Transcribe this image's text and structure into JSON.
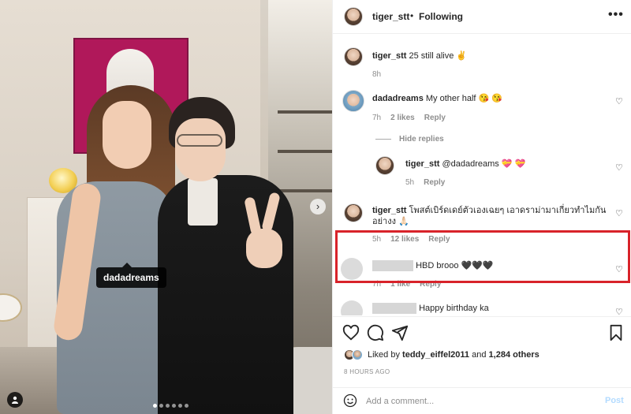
{
  "post": {
    "photo_tag": "dadadreams"
  },
  "header": {
    "username": "tiger_stt",
    "separator": "•",
    "follow_status": "Following",
    "more": "•••"
  },
  "caption": {
    "username": "tiger_stt",
    "text": "25 still alive ✌️",
    "time": "8h"
  },
  "comments": [
    {
      "username": "dadadreams",
      "text": "My other half 😘 😘",
      "time": "7h",
      "likes": "2 likes",
      "reply": "Reply"
    },
    {
      "hide_replies": "Hide replies"
    },
    {
      "username": "tiger_stt",
      "text": "@dadadreams 💝 💝",
      "time": "5h",
      "reply": "Reply"
    },
    {
      "username": "tiger_stt",
      "text": "โพสต์เบิร์ดเดย์ตัวเองเฉยๆ เอาดราม่ามาเกี่ยวทำไมกัน อย่างง 🙏🏻",
      "time": "5h",
      "likes": "12 likes",
      "reply": "Reply"
    },
    {
      "text": "HBD brooo 🖤🖤🖤",
      "time": "7h",
      "likes": "1 like",
      "reply": "Reply"
    },
    {
      "text": "Happy birthday ka"
    }
  ],
  "footer": {
    "liked_by_prefix": "Liked by",
    "liked_by_user": "teddy_eiffel2011",
    "and": "and",
    "others": "1,284 others",
    "time_ago": "8 HOURS AGO"
  },
  "add_comment": {
    "placeholder": "Add a comment...",
    "post_label": "Post"
  },
  "colors": {
    "highlight_border": "#d8232a",
    "post_button": "#b3dbff",
    "text": "#262626",
    "muted": "#8e8e8e"
  },
  "icons": [
    "heart-icon",
    "comment-icon",
    "share-icon",
    "bookmark-icon",
    "emoji-icon",
    "more-icon",
    "chevron-right-icon",
    "user-tag-icon"
  ]
}
